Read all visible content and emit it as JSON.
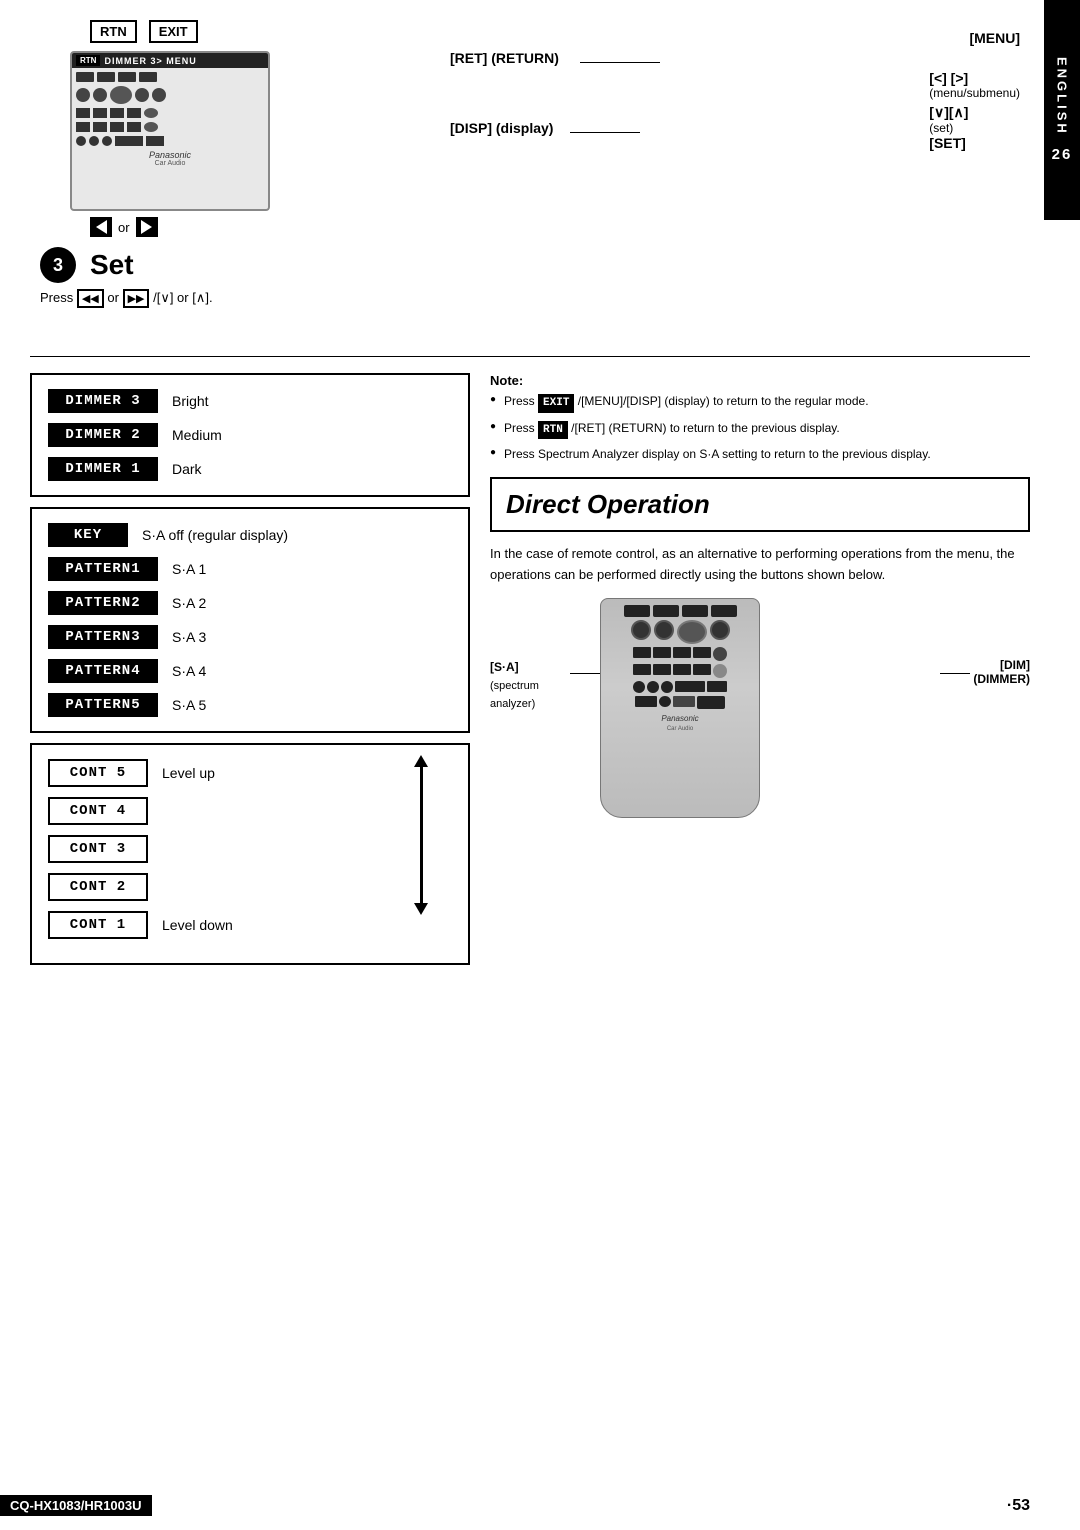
{
  "page": {
    "number": "53",
    "model": "CQ-HX1083/HR1003U",
    "language_tab": "ENGLISH",
    "tab_page": "26"
  },
  "top_section": {
    "buttons": {
      "rtn": "RTN",
      "exit": "EXIT"
    },
    "labels": {
      "ret_return": "[RET] (RETURN)",
      "menu": "[MENU]",
      "disp": "[DISP] (display)",
      "arrows_lr": "[<] [>]",
      "menu_submenu": "(menu/submenu)",
      "arrows_vset": "[∨][∧]",
      "set_label": "(set)",
      "set_bracket": "[SET]"
    }
  },
  "set_section": {
    "number": "3",
    "title": "Set",
    "instruction": "Press  or  /[∨] or [∧]."
  },
  "dimmer_table": {
    "rows": [
      {
        "btn": "DIMMER 3",
        "label": "Bright"
      },
      {
        "btn": "DIMMER 2",
        "label": "Medium"
      },
      {
        "btn": "DIMMER 1",
        "label": "Dark"
      }
    ]
  },
  "pattern_table": {
    "rows": [
      {
        "btn": "KEY",
        "label": "S·A off (regular display)"
      },
      {
        "btn": "PATTERN1",
        "label": "S·A 1"
      },
      {
        "btn": "PATTERN2",
        "label": "S·A 2"
      },
      {
        "btn": "PATTERN3",
        "label": "S·A 3"
      },
      {
        "btn": "PATTERN4",
        "label": "S·A 4"
      },
      {
        "btn": "PATTERN5",
        "label": "S·A 5"
      }
    ]
  },
  "cont_table": {
    "rows": [
      {
        "btn": "CONT 5",
        "label": "Level up"
      },
      {
        "btn": "CONT 4",
        "label": ""
      },
      {
        "btn": "CONT 3",
        "label": ""
      },
      {
        "btn": "CONT 2",
        "label": ""
      },
      {
        "btn": "CONT 1",
        "label": "Level down"
      }
    ]
  },
  "notes": {
    "title": "Note:",
    "items": [
      "Press  EXIT /[MENU]/[DISP] (display) to return to the regular mode.",
      "Press  RTN /[RET] (RETURN) to return to the previous display.",
      "Press Spectrum Analyzer display on S·A setting to return to the previous display."
    ]
  },
  "direct_operation": {
    "title": "Direct Operation",
    "description": "In the case of remote control, as an alternative to performing operations from the menu, the operations can be performed directly using the buttons shown below.",
    "labels": {
      "sa": "[S·A]",
      "sa_sub": "(spectrum\nanalyzer)",
      "dim": "[DIM]",
      "dim_sub": "(DIMMER)"
    }
  }
}
